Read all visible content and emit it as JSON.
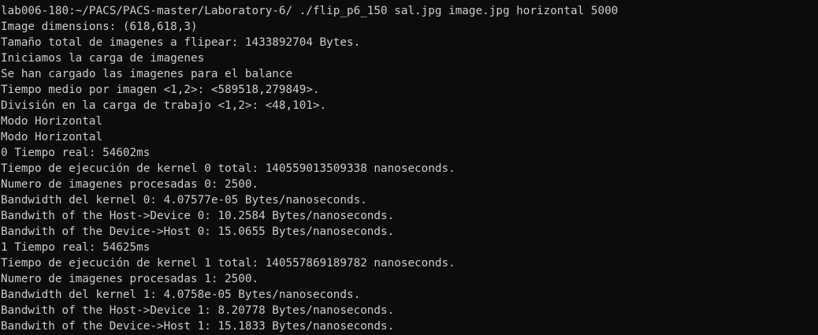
{
  "terminal": {
    "lines": [
      "lab006-180:~/PACS/PACS-master/Laboratory-6/ ./flip_p6_150 sal.jpg image.jpg horizontal 5000",
      "Image dimensions: (618,618,3)",
      "Tamaño total de imagenes a flipear: 1433892704 Bytes.",
      "Iniciamos la carga de imagenes",
      "Se han cargado las imagenes para el balance",
      "Tiempo medio por imagen <1,2>: <589518,279849>.",
      "División en la carga de trabajo <1,2>: <48,101>.",
      "Modo Horizontal",
      "Modo Horizontal",
      "0 Tiempo real: 54602ms",
      "Tiempo de ejecución de kernel 0 total: 140559013509338 nanoseconds.",
      "Numero de imagenes procesadas 0: 2500.",
      "Bandwidth del kernel 0: 4.07577e-05 Bytes/nanoseconds.",
      "Bandwith of the Host->Device 0: 10.2584 Bytes/nanoseconds.",
      "Bandwith of the Device->Host 0: 15.0655 Bytes/nanoseconds.",
      "1 Tiempo real: 54625ms",
      "Tiempo de ejecución de kernel 1 total: 140557869189782 nanoseconds.",
      "Numero de imagenes procesadas 1: 2500.",
      "Bandwidth del kernel 1: 4.0758e-05 Bytes/nanoseconds.",
      "Bandwith of the Host->Device 1: 8.20778 Bytes/nanoseconds.",
      "Bandwith of the Device->Host 1: 15.1833 Bytes/nanoseconds."
    ]
  }
}
